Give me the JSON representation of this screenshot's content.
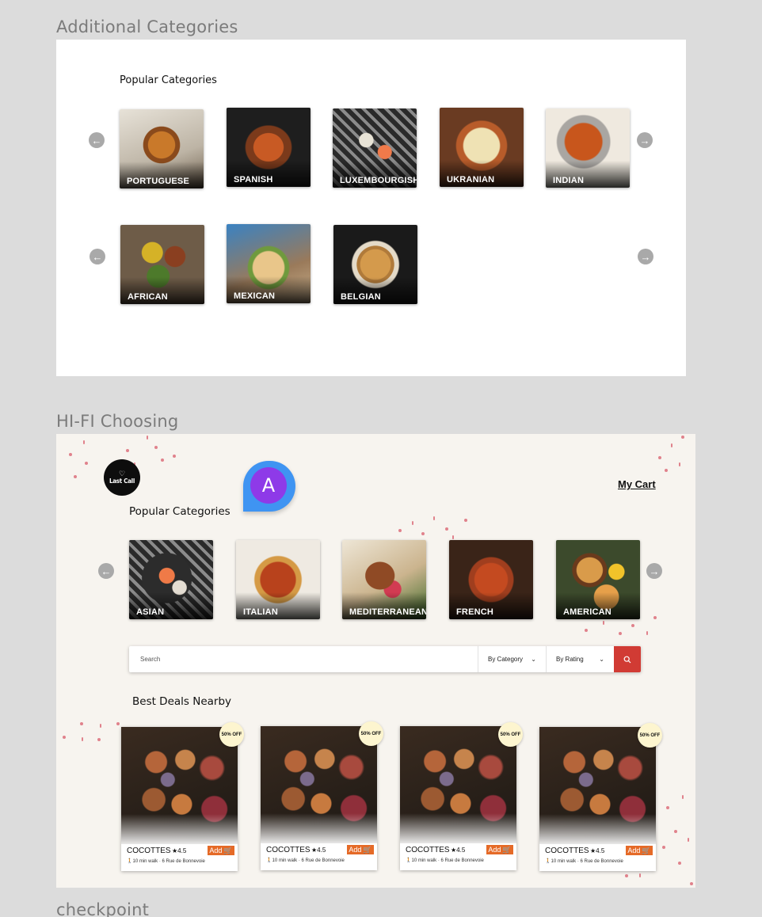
{
  "frames": {
    "additional_label": "Additional Categories",
    "hifi_label": "HI-FI Choosing",
    "checkpoint_label": "checkpoint"
  },
  "additional": {
    "heading": "Popular Categories",
    "row1": [
      "PORTUGUESE",
      "SPANISH",
      "LUXEMBOURGISH",
      "UKRANIAN",
      "INDIAN"
    ],
    "row2": [
      "AFRICAN",
      "MEXICAN",
      "BELGIAN"
    ]
  },
  "hifi": {
    "logo_text": "Last Call",
    "avatar_letter": "A",
    "cart_label": "My Cart",
    "heading": "Popular Categories",
    "categories": [
      "ASIAN",
      "ITALIAN",
      "MEDITERRANEAN",
      "FRENCH",
      "AMERICAN"
    ],
    "search_placeholder": "Search",
    "filter_category": "By Category",
    "filter_rating": "By Rating",
    "deals_heading": "Best Deals Nearby",
    "deals": [
      {
        "name": "COCOTTES",
        "rating": "★4.5",
        "add": "Add",
        "meta": "10 min walk · 6 Rue de Bonnevoie",
        "badge": "50% OFF"
      },
      {
        "name": "COCOTTES",
        "rating": "★4.5",
        "add": "Add",
        "meta": "10 min walk · 6 Rue de Bonnevoie",
        "badge": "50% OFF"
      },
      {
        "name": "COCOTTES",
        "rating": "★4.5",
        "add": "Add",
        "meta": "10 min walk · 6 Rue de Bonnevoie",
        "badge": "50% OFF"
      },
      {
        "name": "COCOTTES",
        "rating": "★4.5",
        "add": "Add",
        "meta": "10 min walk · 6 Rue de Bonnevoie",
        "badge": "50% OFF"
      }
    ]
  },
  "icons": {
    "prev": "arrow-left-circle-icon",
    "next": "arrow-right-circle-icon",
    "search": "search-icon",
    "cart": "cart-icon",
    "walk": "walk-icon",
    "chevron": "chevron-down-icon"
  },
  "colors": {
    "accent_red": "#d13b34",
    "add_orange": "#e56a27",
    "badge_cream": "#fdf5cf",
    "frame_bg": "#f7f4ef",
    "confetti": "#e0828c"
  }
}
